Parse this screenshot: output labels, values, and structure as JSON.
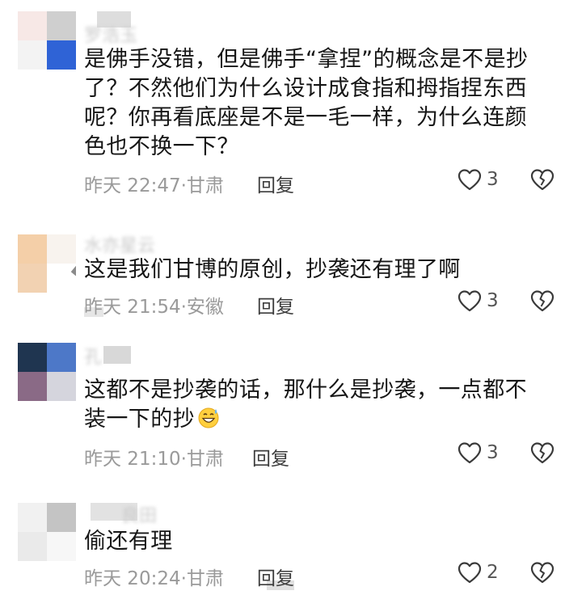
{
  "comments": [
    {
      "username": "罗浩玉",
      "content": "是佛手没错，但是佛手“拿捏”的概念是不是抄了？不然他们为什么设计成食指和拇指捏东西呢？你再看底座是不是一毛一样，为什么连颜色也不换一下？",
      "time": "昨天 22:47",
      "location": "甘肃",
      "reply_label": "回复",
      "likes": "3"
    },
    {
      "username": "水亦星云",
      "content": "这是我们甘博的原创，抄袭还有理了啊",
      "time": "昨天 21:54",
      "location": "安徽",
      "reply_label": "回复",
      "likes": "3"
    },
    {
      "username": "孔",
      "content": "这都不是抄袭的话，那什么是抄袭，一点都不装一下的抄",
      "time": "昨天 21:10",
      "location": "甘肃",
      "reply_label": "回复",
      "likes": "3",
      "emoji": "grinning-sweat-emoji"
    },
    {
      "username": "良田",
      "content": "偷还有理",
      "time": "昨天 20:24",
      "location": "甘肃",
      "reply_label": "回复",
      "likes": "2"
    }
  ],
  "icons": {
    "like": "heart-outline-icon",
    "dislike": "broken-heart-icon"
  },
  "colors": {
    "text": "#161616",
    "meta": "#9a9a9a",
    "reply": "#3c3c3c"
  }
}
